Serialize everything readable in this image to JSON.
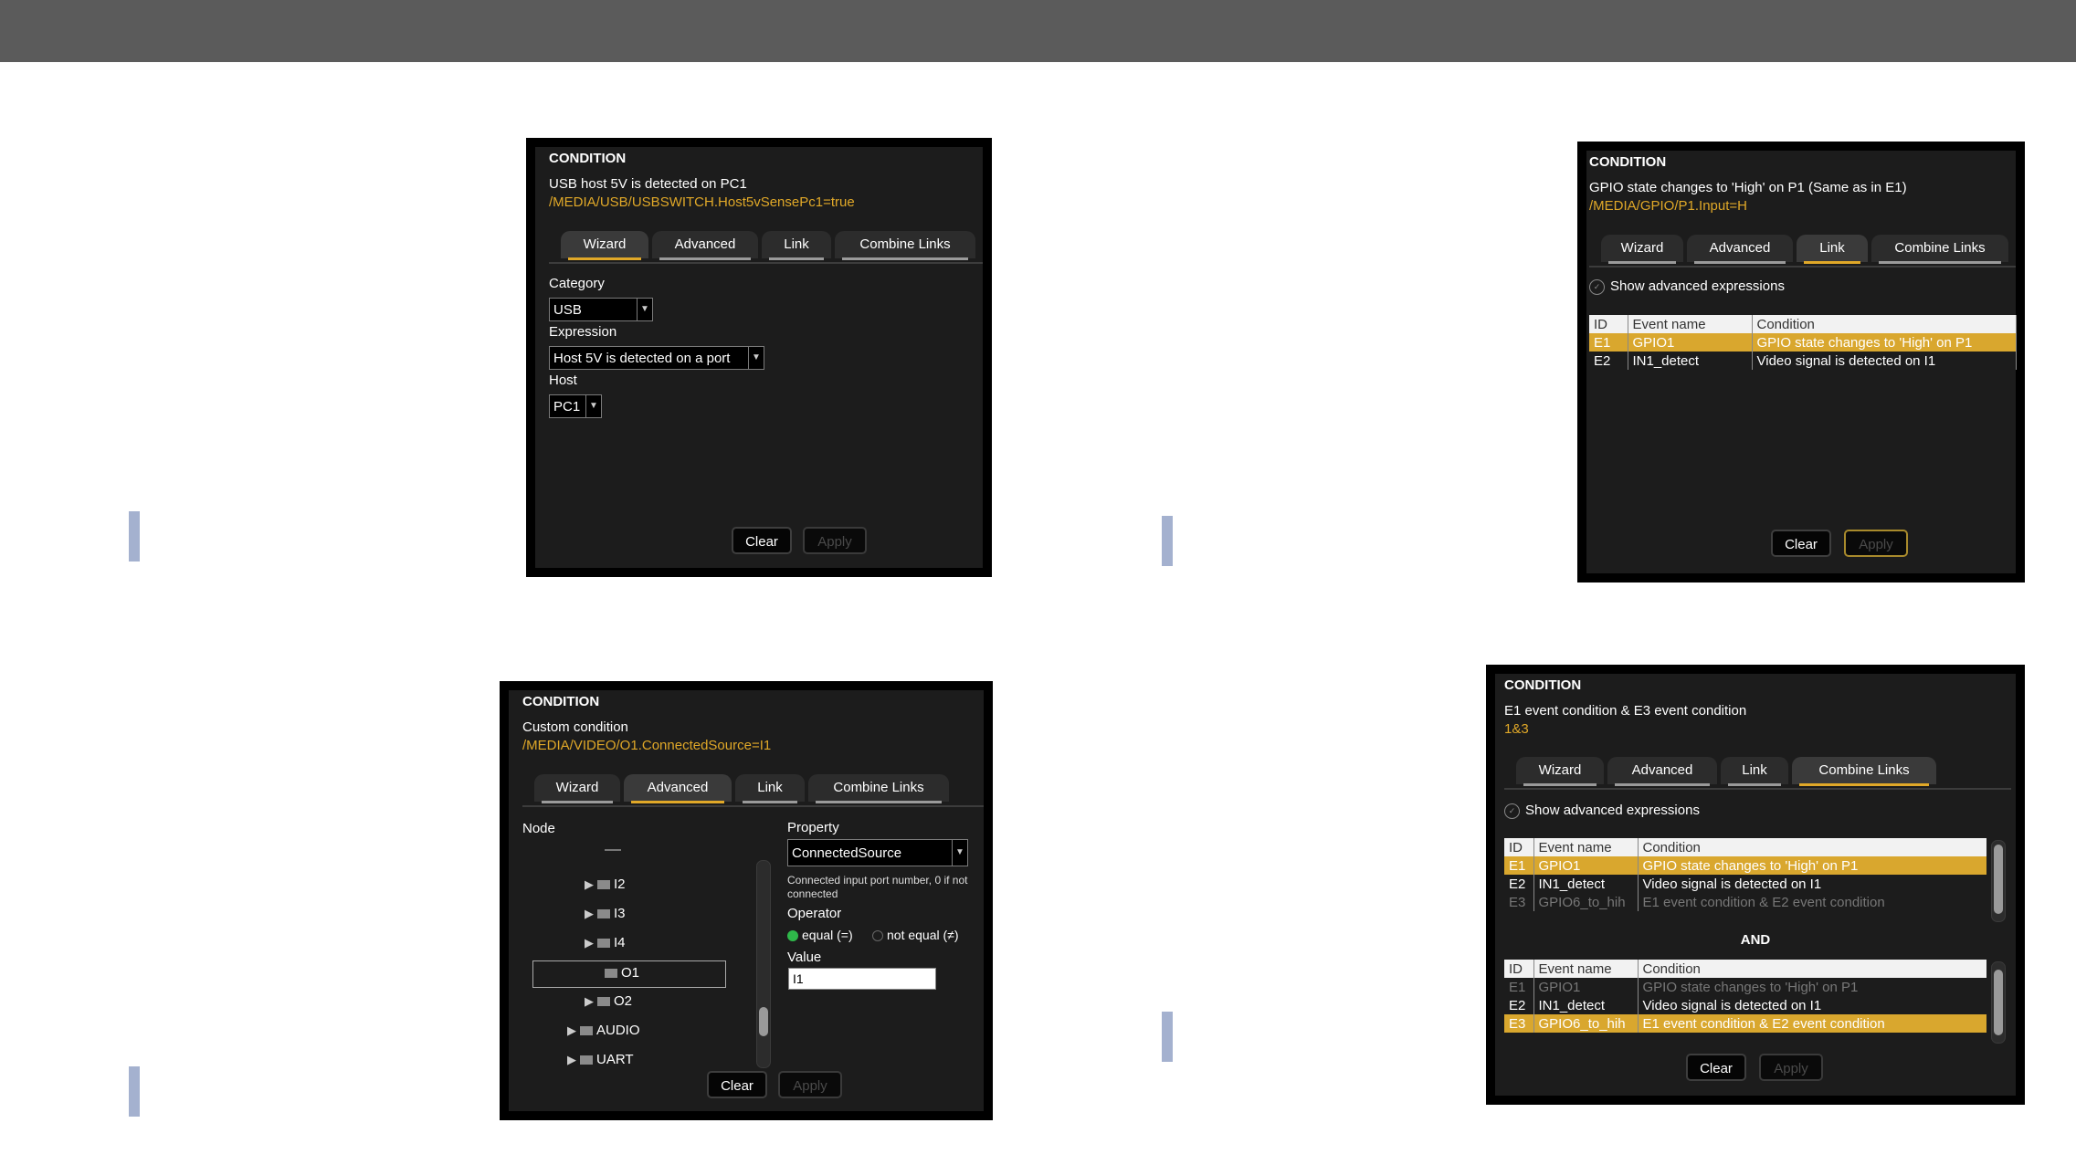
{
  "tabs": [
    "Wizard",
    "Advanced",
    "Link",
    "Combine Links"
  ],
  "buttons": {
    "clear": "Clear",
    "apply": "Apply"
  },
  "panel1": {
    "title": "CONDITION",
    "description": "USB host 5V is detected on PC1",
    "path": "/MEDIA/USB/USBSWITCH.Host5vSensePc1=true",
    "active_tab": "Wizard",
    "category_label": "Category",
    "category_value": "USB",
    "expression_label": "Expression",
    "expression_value": "Host 5V is detected on a port",
    "host_label": "Host",
    "host_value": "PC1"
  },
  "panel2": {
    "title": "CONDITION",
    "description": "GPIO state changes to 'High' on P1 (Same as in E1)",
    "path": "/MEDIA/GPIO/P1.Input=H",
    "active_tab": "Link",
    "show_advanced": "Show advanced expressions",
    "table": {
      "headers": [
        "ID",
        "Event name",
        "Condition"
      ],
      "rows": [
        [
          "E1",
          "GPIO1",
          "GPIO state changes to 'High' on P1"
        ],
        [
          "E2",
          "IN1_detect",
          "Video signal is detected on I1"
        ]
      ]
    }
  },
  "panel3": {
    "title": "CONDITION",
    "description": "Custom condition",
    "path": "/MEDIA/VIDEO/O1.ConnectedSource=I1",
    "active_tab": "Advanced",
    "node_label": "Node",
    "tree": [
      "I2",
      "I3",
      "I4",
      "O1",
      "O2",
      "AUDIO",
      "UART"
    ],
    "property_label": "Property",
    "property_value": "ConnectedSource",
    "property_help": "Connected input port number, 0 if not connected",
    "operator_label": "Operator",
    "operator_equal": "equal (=)",
    "operator_not_equal": "not equal (≠)",
    "value_label": "Value",
    "value": "I1"
  },
  "panel4": {
    "title": "CONDITION",
    "description": "E1 event condition & E3 event condition",
    "path": "1&3",
    "active_tab": "Combine Links",
    "show_advanced": "Show advanced expressions",
    "and_label": "AND",
    "headers": [
      "ID",
      "Event name",
      "Condition"
    ],
    "table1_rows": [
      [
        "E1",
        "GPIO1",
        "GPIO state changes to 'High' on P1"
      ],
      [
        "E2",
        "IN1_detect",
        "Video signal is detected on I1"
      ],
      [
        "E3",
        "GPIO6_to_hih",
        "E1 event condition & E2 event condition"
      ]
    ],
    "table2_rows": [
      [
        "E1",
        "GPIO1",
        "GPIO state changes to 'High' on P1"
      ],
      [
        "E2",
        "IN1_detect",
        "Video signal is detected on I1"
      ],
      [
        "E3",
        "GPIO6_to_hih",
        "E1 event condition & E2 event condition"
      ]
    ]
  }
}
